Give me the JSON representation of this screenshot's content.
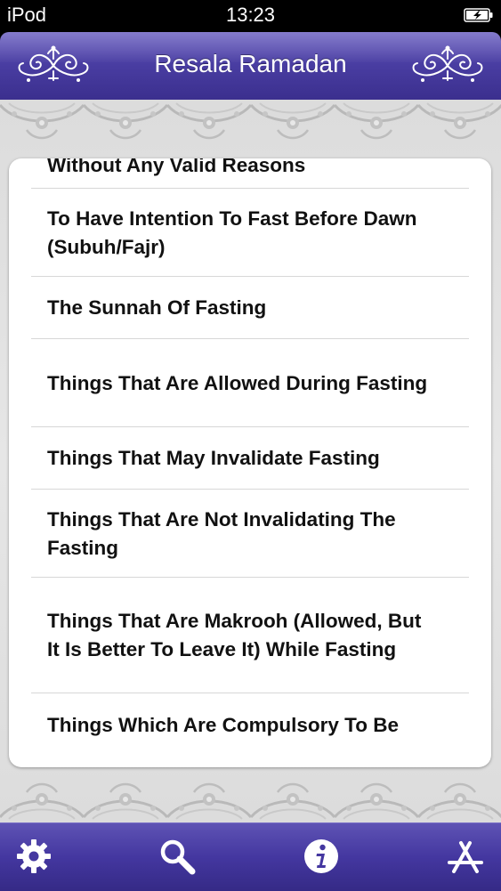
{
  "status_bar": {
    "carrier": "iPod",
    "time": "13:23"
  },
  "nav_bar": {
    "title": "Resala Ramadan"
  },
  "list": {
    "items": [
      {
        "label": "Without Any Valid Reasons"
      },
      {
        "label": "To Have Intention To Fast Before Dawn (Subuh/Fajr)"
      },
      {
        "label": "The Sunnah Of Fasting"
      },
      {
        "label": "Things That Are Allowed During Fasting"
      },
      {
        "label": "Things That May Invalidate Fasting"
      },
      {
        "label": "Things That Are Not Invalidating The Fasting"
      },
      {
        "label": "Things That Are Makrooh (Allowed, But It Is Better To Leave It) While Fasting"
      },
      {
        "label": "Things Which Are Compulsory To Be"
      }
    ]
  },
  "tab_bar": {
    "tabs": [
      {
        "icon": "gear-icon"
      },
      {
        "icon": "search-icon"
      },
      {
        "icon": "info-icon"
      },
      {
        "icon": "app-store-icon"
      }
    ]
  },
  "colors": {
    "nav_purple": "#4a3ea3",
    "tab_purple": "#4437a0",
    "panel_bg": "#ffffff",
    "page_bg": "#e0e0e0"
  }
}
